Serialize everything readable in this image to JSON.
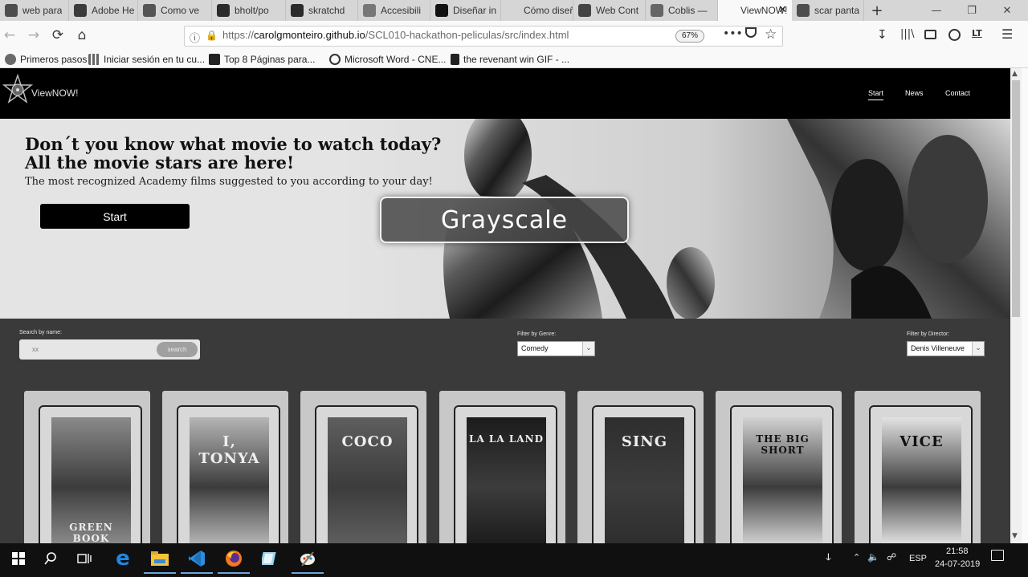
{
  "browser": {
    "tabs": [
      {
        "label": "web para",
        "icon": "google-icon",
        "color": "#4d4d4d"
      },
      {
        "label": "Adobe He",
        "icon": "adobe-icon",
        "color": "#3b3b3b"
      },
      {
        "label": "Como ve",
        "icon": "page-icon",
        "color": "#555555"
      },
      {
        "label": "bholt/po",
        "icon": "github-icon",
        "color": "#2b2b2b"
      },
      {
        "label": "skratchd",
        "icon": "github-icon",
        "color": "#2b2b2b"
      },
      {
        "label": "Accesibili",
        "icon": "image-icon",
        "color": "#777777"
      },
      {
        "label": "Diseñar in",
        "icon": "medium-icon",
        "color": "#111111"
      },
      {
        "label": "Cómo diseñar",
        "icon": "blank-icon",
        "color": "#d6d6d6"
      },
      {
        "label": "Web Cont",
        "icon": "w3-icon",
        "color": "#444444"
      },
      {
        "label": "Coblis —",
        "icon": "coblis-icon",
        "color": "#666666"
      },
      {
        "label": "ViewNOW!",
        "icon": "blank-icon",
        "color": "#f9f9f9"
      },
      {
        "label": "scar panta",
        "icon": "google-icon",
        "color": "#4d4d4d"
      }
    ],
    "active_tab_index": 10,
    "new_tab": "+",
    "url_prefix": "https://",
    "url_host": "carolgmonteiro.github.io",
    "url_path": "/SCL010-hackathon-peliculas/src/index.html",
    "zoom": "67%",
    "page_actions": "•••",
    "bookmarks": [
      {
        "label": "Primeros pasos",
        "icon": "firefox-icon"
      },
      {
        "label": "Iniciar sesión en tu cu...",
        "icon": "grid-icon"
      },
      {
        "label": "Top 8 Páginas para...",
        "icon": "hoy-icon"
      },
      {
        "label": "Microsoft Word - CNE...",
        "icon": "globe-icon"
      },
      {
        "label": "the revenant win GIF - ...",
        "icon": "file-icon"
      }
    ]
  },
  "site": {
    "logo": "ViewNOW!",
    "nav": [
      "Start",
      "News",
      "Contact"
    ],
    "hero_title": "Don´t you know what movie to watch today? All the movie stars are here!",
    "hero_subtitle": "The most recognized Academy films suggested to you according to your day!",
    "hero_button": "Start",
    "search_label": "Search by name:",
    "search_value": "xx",
    "search_button": "search",
    "genre_label": "Filter by Genre:",
    "genre_value": "Comedy",
    "director_label": "Filter by Director:",
    "director_value": "Denis Villeneuve",
    "movies": [
      {
        "title": "GREEN BOOK",
        "tone": "#8a8a8a"
      },
      {
        "title": "I, TONYA",
        "tone": "#b5b5b5"
      },
      {
        "title": "COCO",
        "tone": "#5e5e5e"
      },
      {
        "title": "LA LA LAND",
        "tone": "#1c1c1c"
      },
      {
        "title": "SING",
        "tone": "#2e2e2e"
      },
      {
        "title": "THE BIG SHORT",
        "tone": "#d2d2d2"
      },
      {
        "title": "VICE",
        "tone": "#e2e2e2"
      }
    ]
  },
  "overlay": {
    "label": "Grayscale"
  },
  "taskbar": {
    "apps": [
      "start-icon",
      "search-icon",
      "task-view-icon",
      "edge-icon",
      "file-explorer-icon",
      "vscode-icon",
      "firefox-icon",
      "notepad-icon",
      "paint-icon"
    ],
    "language": "ESP",
    "time": "21:58",
    "date": "24-07-2019"
  }
}
